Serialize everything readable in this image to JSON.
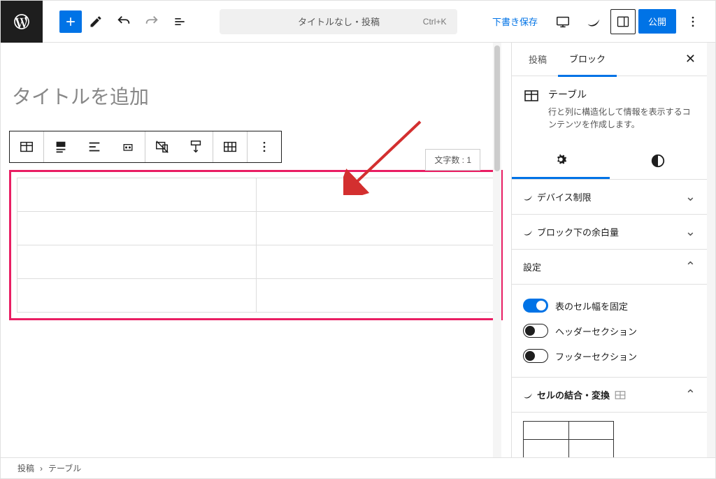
{
  "header": {
    "doc_title": "タイトルなし・投稿",
    "shortcut": "Ctrl+K",
    "save_draft": "下書き保存",
    "publish": "公開"
  },
  "editor": {
    "title_placeholder": "タイトルを追加",
    "char_count_label": "文字数 : 1"
  },
  "sidebar": {
    "tabs": {
      "post": "投稿",
      "block": "ブロック"
    },
    "block_info": {
      "name": "テーブル",
      "description": "行と列に構造化して情報を表示するコンテンツを作成します。"
    },
    "panels": {
      "device_limit": "デバイス制限",
      "margin_below": "ブロック下の余白量",
      "settings": "設定",
      "merge_convert": "セルの結合・変換"
    },
    "settings": {
      "fixed_width": "表のセル幅を固定",
      "header_section": "ヘッダーセクション",
      "footer_section": "フッターセクション"
    }
  },
  "breadcrumb": {
    "post": "投稿",
    "table": "テーブル"
  },
  "table": {
    "rows": 4,
    "cols": 2
  }
}
